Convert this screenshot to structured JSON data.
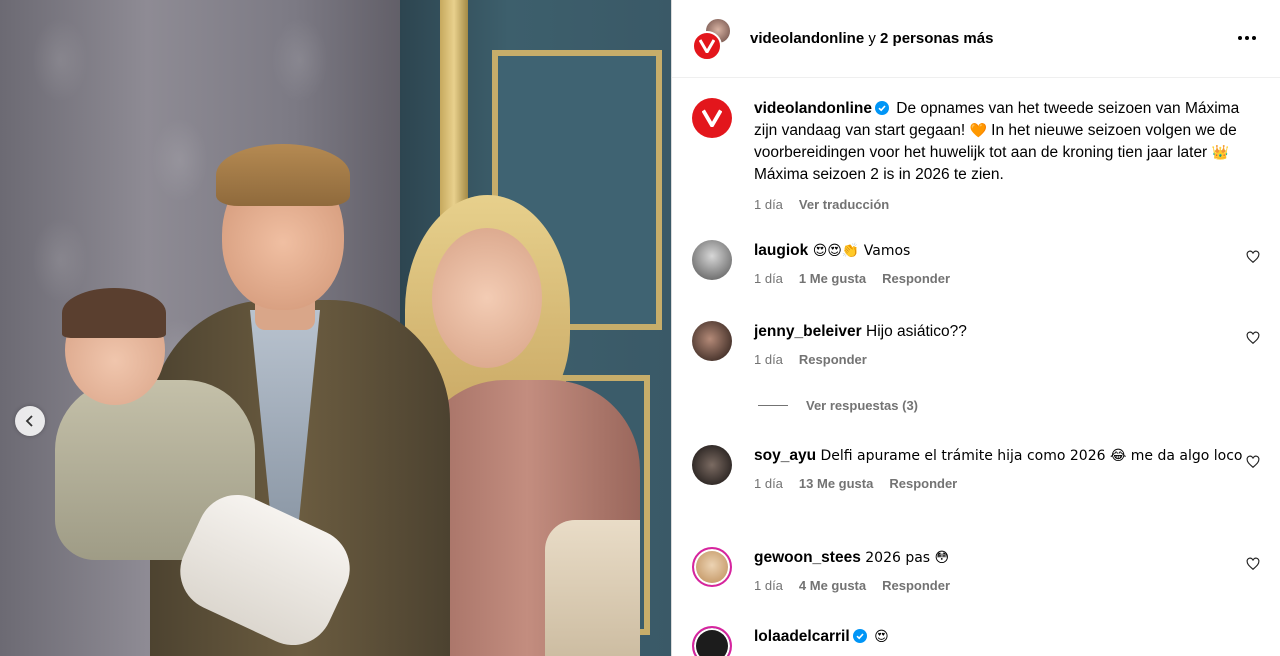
{
  "header": {
    "username": "videolandonline",
    "connector": " y ",
    "others": "2 personas más"
  },
  "caption": {
    "username": "videolandonline",
    "text_1": " De opnames van het tweede seizoen van Máxima zijn vandaag van start gegaan! ",
    "emoji_1": "🧡",
    "text_2": " In het nieuwe seizoen volgen we de voorbereidingen voor het huwelijk tot aan de kroning tien jaar later ",
    "emoji_2": "👑",
    "text_3": " Máxima seizoen 2 is in 2026 te zien.",
    "time": "1 día",
    "translate": "Ver traducción"
  },
  "comments": [
    {
      "username": "laugiok",
      "text": " 😍😍👏 Vamos",
      "time": "1 día",
      "likes": "1 Me gusta",
      "reply": "Responder"
    },
    {
      "username": "jenny_beleiver",
      "text": " Hijo asiático??",
      "time": "1 día",
      "likes": "",
      "reply": "Responder"
    },
    {
      "username": "soy_ayu",
      "text": " Delfi apurame el trámite hija como 2026 😂 me da algo loco",
      "time": "1 día",
      "likes": "13 Me gusta",
      "reply": "Responder"
    },
    {
      "username": "gewoon_stees",
      "text": " 2026 pas 😳",
      "time": "1 día",
      "likes": "4 Me gusta",
      "reply": "Responder"
    },
    {
      "username": "lolaadelcarril",
      "text": " 😍",
      "time": "",
      "likes": "",
      "reply": ""
    }
  ],
  "view_replies": "Ver respuestas (3)",
  "colors": {
    "brand_red": "#e3161c",
    "verified_blue": "#0095f6",
    "meta_gray": "#737373"
  }
}
